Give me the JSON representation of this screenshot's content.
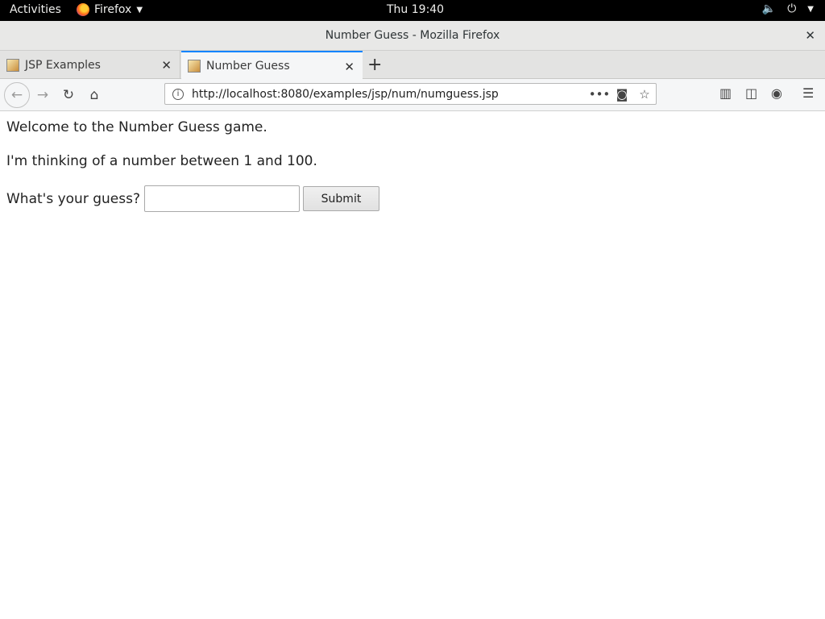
{
  "topbar": {
    "activities": "Activities",
    "app_name": "Firefox",
    "clock": "Thu 19:40"
  },
  "window": {
    "title": "Number Guess - Mozilla Firefox"
  },
  "tabs": [
    {
      "label": "JSP Examples",
      "active": false
    },
    {
      "label": "Number Guess",
      "active": true
    }
  ],
  "navbar": {
    "url": "http://localhost:8080/examples/jsp/num/numguess.jsp"
  },
  "page": {
    "welcome": "Welcome to the Number Guess game.",
    "thinking": "I'm thinking of a number between 1 and 100.",
    "guess_label": "What's your guess?",
    "guess_value": "",
    "submit_label": "Submit"
  },
  "colors": {
    "accent": "#0a84ff",
    "topbar": "#000000"
  }
}
